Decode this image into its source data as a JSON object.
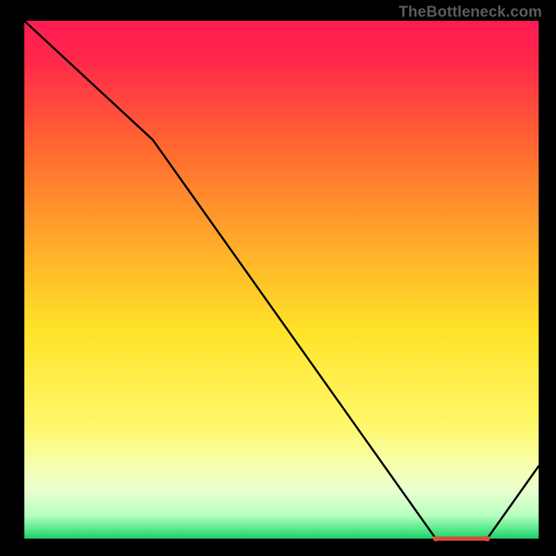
{
  "watermark": "TheBottleneck.com",
  "chart_data": {
    "type": "line",
    "title": "",
    "xlabel": "",
    "ylabel": "",
    "xlim": [
      0,
      100
    ],
    "ylim": [
      0,
      100
    ],
    "x": [
      0,
      25,
      80,
      90,
      100
    ],
    "values": [
      100,
      77,
      0,
      0,
      14
    ],
    "flat_segment": {
      "x0": 80,
      "x1": 90,
      "y": 0
    },
    "gradient_stops": [
      {
        "pos": 0.0,
        "color": "#ff1a52"
      },
      {
        "pos": 0.08,
        "color": "#ff2a4a"
      },
      {
        "pos": 0.25,
        "color": "#ff6a2f"
      },
      {
        "pos": 0.45,
        "color": "#ffb22a"
      },
      {
        "pos": 0.6,
        "color": "#ffe329"
      },
      {
        "pos": 0.78,
        "color": "#fff86a"
      },
      {
        "pos": 0.86,
        "color": "#f6ffb0"
      },
      {
        "pos": 0.91,
        "color": "#e8ffd0"
      },
      {
        "pos": 0.955,
        "color": "#b7ffc0"
      },
      {
        "pos": 0.99,
        "color": "#3ae07a"
      },
      {
        "pos": 1.0,
        "color": "#1fc96a"
      }
    ]
  }
}
